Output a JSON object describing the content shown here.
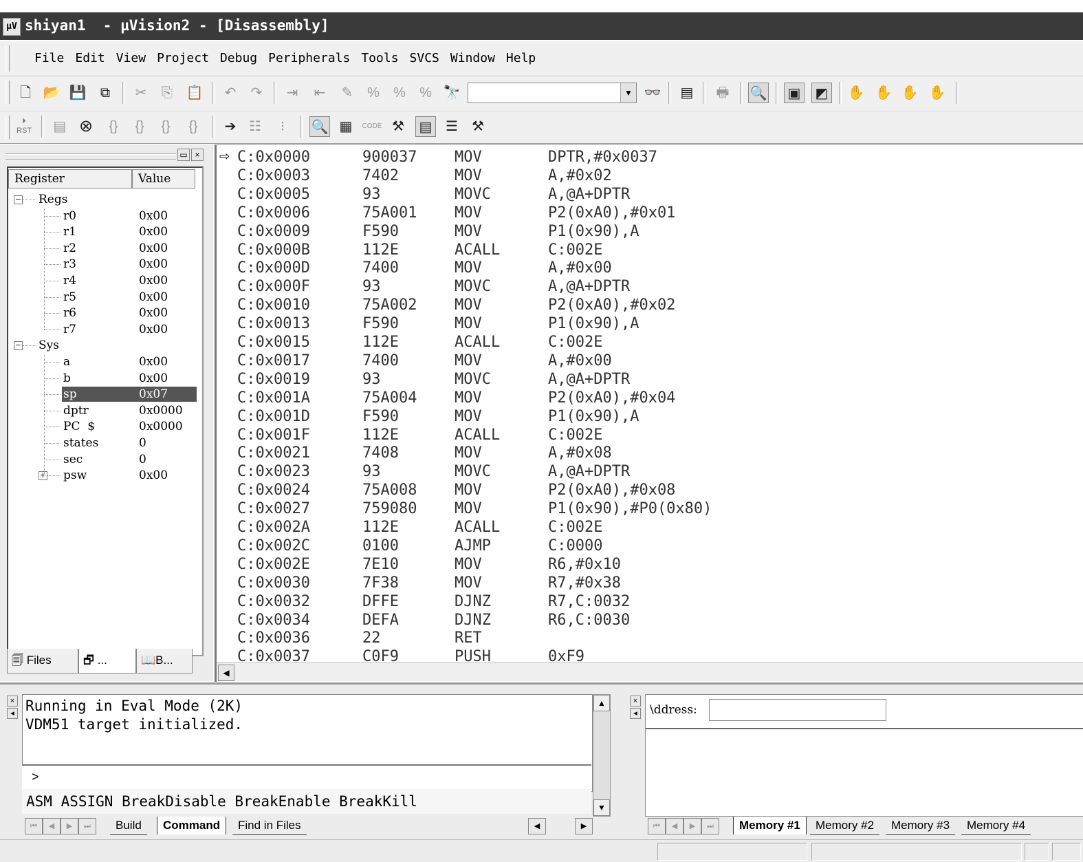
{
  "title": "shiyan1  - µVision2 - [Disassembly]",
  "app_icon": "µV",
  "menu": [
    "File",
    "Edit",
    "View",
    "Project",
    "Debug",
    "Peripherals",
    "Tools",
    "SVCS",
    "Window",
    "Help"
  ],
  "toolbar": {
    "find_value": "",
    "reset_label": "RST"
  },
  "register_panel": {
    "col_register": "Register",
    "col_value": "Value",
    "groups": [
      {
        "name": "Regs",
        "expanded": true,
        "items": [
          {
            "name": "r0",
            "value": "0x00"
          },
          {
            "name": "r1",
            "value": "0x00"
          },
          {
            "name": "r2",
            "value": "0x00"
          },
          {
            "name": "r3",
            "value": "0x00"
          },
          {
            "name": "r4",
            "value": "0x00"
          },
          {
            "name": "r5",
            "value": "0x00"
          },
          {
            "name": "r6",
            "value": "0x00"
          },
          {
            "name": "r7",
            "value": "0x00"
          }
        ]
      },
      {
        "name": "Sys",
        "expanded": true,
        "items": [
          {
            "name": "a",
            "value": "0x00"
          },
          {
            "name": "b",
            "value": "0x00"
          },
          {
            "name": "sp",
            "value": "0x07",
            "selected": true
          },
          {
            "name": "dptr",
            "value": "0x0000"
          },
          {
            "name": "PC  $",
            "value": "0x0000"
          },
          {
            "name": "states",
            "value": "0"
          },
          {
            "name": "sec",
            "value": "0"
          },
          {
            "name": "psw",
            "value": "0x00",
            "collapsed": true
          }
        ]
      }
    ],
    "tabs": [
      "Files",
      "...",
      "B..."
    ]
  },
  "disassembly": {
    "current_line": 0,
    "lines": [
      {
        "addr": "C:0x0000",
        "code": "900037",
        "mnem": "MOV",
        "ops": "DPTR,#0x0037"
      },
      {
        "addr": "C:0x0003",
        "code": "7402",
        "mnem": "MOV",
        "ops": "A,#0x02"
      },
      {
        "addr": "C:0x0005",
        "code": "93",
        "mnem": "MOVC",
        "ops": "A,@A+DPTR"
      },
      {
        "addr": "C:0x0006",
        "code": "75A001",
        "mnem": "MOV",
        "ops": "P2(0xA0),#0x01"
      },
      {
        "addr": "C:0x0009",
        "code": "F590",
        "mnem": "MOV",
        "ops": "P1(0x90),A"
      },
      {
        "addr": "C:0x000B",
        "code": "112E",
        "mnem": "ACALL",
        "ops": "C:002E"
      },
      {
        "addr": "C:0x000D",
        "code": "7400",
        "mnem": "MOV",
        "ops": "A,#0x00"
      },
      {
        "addr": "C:0x000F",
        "code": "93",
        "mnem": "MOVC",
        "ops": "A,@A+DPTR"
      },
      {
        "addr": "C:0x0010",
        "code": "75A002",
        "mnem": "MOV",
        "ops": "P2(0xA0),#0x02"
      },
      {
        "addr": "C:0x0013",
        "code": "F590",
        "mnem": "MOV",
        "ops": "P1(0x90),A"
      },
      {
        "addr": "C:0x0015",
        "code": "112E",
        "mnem": "ACALL",
        "ops": "C:002E"
      },
      {
        "addr": "C:0x0017",
        "code": "7400",
        "mnem": "MOV",
        "ops": "A,#0x00"
      },
      {
        "addr": "C:0x0019",
        "code": "93",
        "mnem": "MOVC",
        "ops": "A,@A+DPTR"
      },
      {
        "addr": "C:0x001A",
        "code": "75A004",
        "mnem": "MOV",
        "ops": "P2(0xA0),#0x04"
      },
      {
        "addr": "C:0x001D",
        "code": "F590",
        "mnem": "MOV",
        "ops": "P1(0x90),A"
      },
      {
        "addr": "C:0x001F",
        "code": "112E",
        "mnem": "ACALL",
        "ops": "C:002E"
      },
      {
        "addr": "C:0x0021",
        "code": "7408",
        "mnem": "MOV",
        "ops": "A,#0x08"
      },
      {
        "addr": "C:0x0023",
        "code": "93",
        "mnem": "MOVC",
        "ops": "A,@A+DPTR"
      },
      {
        "addr": "C:0x0024",
        "code": "75A008",
        "mnem": "MOV",
        "ops": "P2(0xA0),#0x08"
      },
      {
        "addr": "C:0x0027",
        "code": "759080",
        "mnem": "MOV",
        "ops": "P1(0x90),#P0(0x80)"
      },
      {
        "addr": "C:0x002A",
        "code": "112E",
        "mnem": "ACALL",
        "ops": "C:002E"
      },
      {
        "addr": "C:0x002C",
        "code": "0100",
        "mnem": "AJMP",
        "ops": "C:0000"
      },
      {
        "addr": "C:0x002E",
        "code": "7E10",
        "mnem": "MOV",
        "ops": "R6,#0x10"
      },
      {
        "addr": "C:0x0030",
        "code": "7F38",
        "mnem": "MOV",
        "ops": "R7,#0x38"
      },
      {
        "addr": "C:0x0032",
        "code": "DFFE",
        "mnem": "DJNZ",
        "ops": "R7,C:0032"
      },
      {
        "addr": "C:0x0034",
        "code": "DEFA",
        "mnem": "DJNZ",
        "ops": "R6,C:0030"
      },
      {
        "addr": "C:0x0036",
        "code": "22",
        "mnem": "RET",
        "ops": ""
      },
      {
        "addr": "C:0x0037",
        "code": "C0F9",
        "mnem": "PUSH",
        "ops": "0xF9"
      }
    ]
  },
  "command": {
    "output": [
      "Running in Eval Mode (2K)",
      "VDM51 target initialized."
    ],
    "prompt": ">",
    "hint": "ASM ASSIGN BreakDisable BreakEnable BreakKill",
    "tabs": [
      "Build",
      "Command",
      "Find in Files"
    ],
    "active_tab": "Command"
  },
  "memory": {
    "address_label": "\\ddress:",
    "address_value": "",
    "tabs": [
      "Memory #1",
      "Memory #2",
      "Memory #3",
      "Memory #4"
    ],
    "active_tab": "Memory #1"
  }
}
